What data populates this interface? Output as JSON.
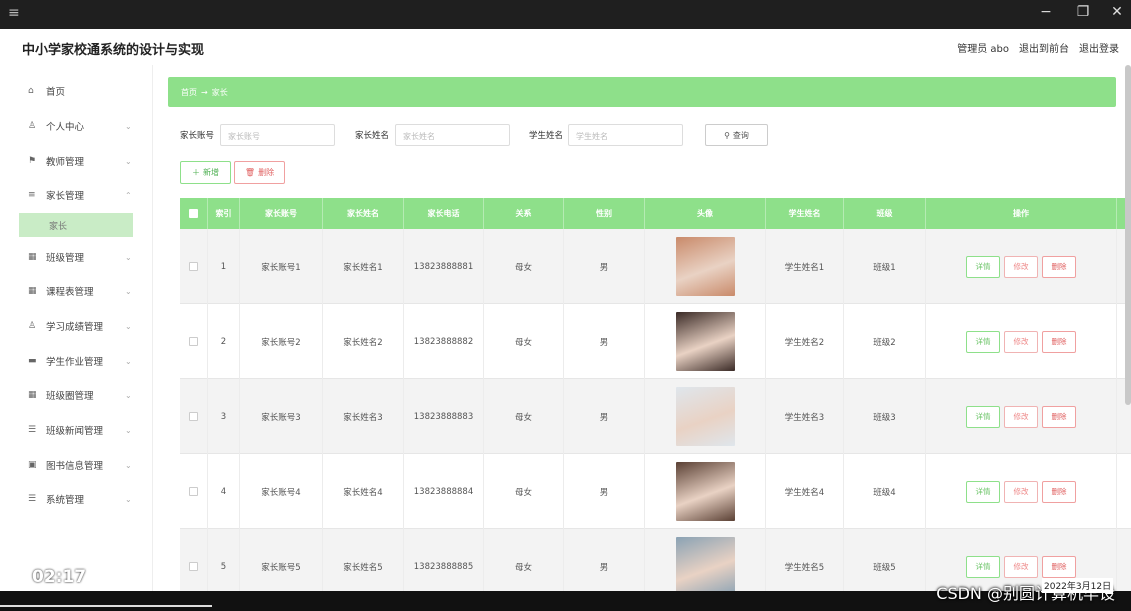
{
  "header": {
    "title": "中小学家校通系统的设计与实现",
    "admin": "管理员 abo",
    "to_front": "退出到前台",
    "logout": "退出登录"
  },
  "sidebar": {
    "items": [
      {
        "label": "首页",
        "icon": "home-icon"
      },
      {
        "label": "个人中心",
        "icon": "user-icon"
      },
      {
        "label": "教师管理",
        "icon": "flag-icon"
      },
      {
        "label": "家长管理",
        "icon": "menu-icon"
      },
      {
        "label": "班级管理",
        "icon": "grid-icon"
      },
      {
        "label": "课程表管理",
        "icon": "grid-icon"
      },
      {
        "label": "学习成绩管理",
        "icon": "user-icon"
      },
      {
        "label": "学生作业管理",
        "icon": "card-icon"
      },
      {
        "label": "班级圈管理",
        "icon": "grid-icon"
      },
      {
        "label": "班级新闻管理",
        "icon": "filter-icon"
      },
      {
        "label": "图书信息管理",
        "icon": "lock-icon"
      },
      {
        "label": "系统管理",
        "icon": "stack-icon"
      }
    ],
    "sub_active": "家长",
    "timecode": "02:17"
  },
  "breadcrumb": {
    "home": "首页",
    "arrow": "→",
    "current": "家长"
  },
  "filters": {
    "account_label": "家长账号",
    "account_placeholder": "家长账号",
    "name_label": "家长姓名",
    "name_placeholder": "家长姓名",
    "student_label": "学生姓名",
    "student_placeholder": "学生姓名",
    "search": "查询"
  },
  "actions": {
    "add": "新增",
    "delete": "删除"
  },
  "table": {
    "headers": [
      "索引",
      "家长账号",
      "家长姓名",
      "家长电话",
      "关系",
      "性别",
      "头像",
      "学生姓名",
      "班级",
      "操作"
    ],
    "rows": [
      {
        "idx": "1",
        "account": "家长账号1",
        "name": "家长姓名1",
        "phone": "13823888881",
        "relation": "母女",
        "gender": "男",
        "student": "学生姓名1",
        "class": "班级1",
        "avatar_color": "#c98a6a"
      },
      {
        "idx": "2",
        "account": "家长账号2",
        "name": "家长姓名2",
        "phone": "13823888882",
        "relation": "母女",
        "gender": "男",
        "student": "学生姓名2",
        "class": "班级2",
        "avatar_color": "#3a2a26"
      },
      {
        "idx": "3",
        "account": "家长账号3",
        "name": "家长姓名3",
        "phone": "13823888883",
        "relation": "母女",
        "gender": "男",
        "student": "学生姓名3",
        "class": "班级3",
        "avatar_color": "#dfe6ec"
      },
      {
        "idx": "4",
        "account": "家长账号4",
        "name": "家长姓名4",
        "phone": "13823888884",
        "relation": "母女",
        "gender": "男",
        "student": "学生姓名4",
        "class": "班级4",
        "avatar_color": "#5a4034"
      },
      {
        "idx": "5",
        "account": "家长账号5",
        "name": "家长姓名5",
        "phone": "13823888885",
        "relation": "母女",
        "gender": "男",
        "student": "学生姓名5",
        "class": "班级5",
        "avatar_color": "#8aa2b4"
      }
    ],
    "op_detail": "详情",
    "op_edit": "修改",
    "op_delete": "删除"
  },
  "overlay": {
    "watermark": "CSDN @别圆计算机毕设",
    "stamp": "2022年3月12日"
  },
  "colors": {
    "accent": "#8ee08a",
    "danger": "#e06060"
  }
}
